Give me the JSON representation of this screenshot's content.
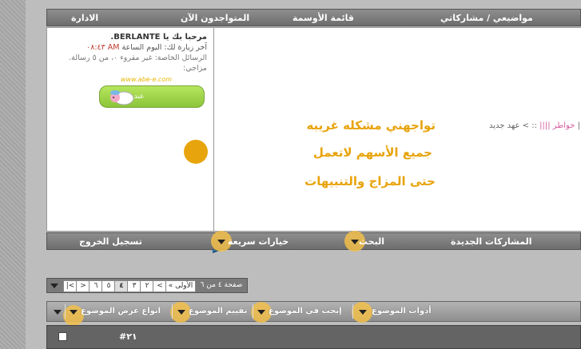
{
  "top_nav": {
    "admin": "الادارة",
    "online_now": "المتواجدون الآن",
    "medals": "قائمة الأوسمة",
    "my_topics": "مواضيعي / مشاركاتي"
  },
  "user_panel": {
    "welcome": "مرحبا بك يا BERLANTE.",
    "last_visit": "آخر زيارة لك: اليوم الساعة",
    "last_visit_time": "AM ٠٨:٤٣",
    "private_messages": "الرسائل الخاصة: غير مقروء ٠، من ٥ رسالة.",
    "mood_label": "مزاجي:",
    "mood_site": "www.abe-e.com",
    "mood_text": "عندي نوم"
  },
  "content": {
    "breadcrumb_prefix": "عهد جديد ||",
    "breadcrumb_sep": ":: >",
    "breadcrumb_link": "خواطر ||||",
    "issue_line_1": "تواجهني مشكله غريبه",
    "issue_line_2": "جميع الأسهم لاتعمل",
    "issue_line_3": "حتى المزاج والتنبيهات"
  },
  "nav2": {
    "new_posts": "المشاركات الجديدة",
    "search": "البحث",
    "quick_options": "خيارات سريعة",
    "logout": "تسجيل الخروج"
  },
  "pagination": {
    "page_label": "صفحة ٤ من ٦",
    "first": "« الأولى",
    "prev": "<",
    "pages": [
      "٢",
      "٣",
      "٤",
      "٥",
      "٦"
    ],
    "next": ">",
    "last": "|<"
  },
  "thread_tools": {
    "tools": "أدوات الموضوع",
    "search_thread": "إبحث في الموضوع",
    "rate_thread": "تقييم الموضوع",
    "display_modes": "انواع عرض الموضوع"
  },
  "post": {
    "number": "#٢١"
  },
  "colors": {
    "accent_yellow": "#e8a40c",
    "nav_gray": "#7a7a7a",
    "mood_green": "#8cc53a"
  }
}
